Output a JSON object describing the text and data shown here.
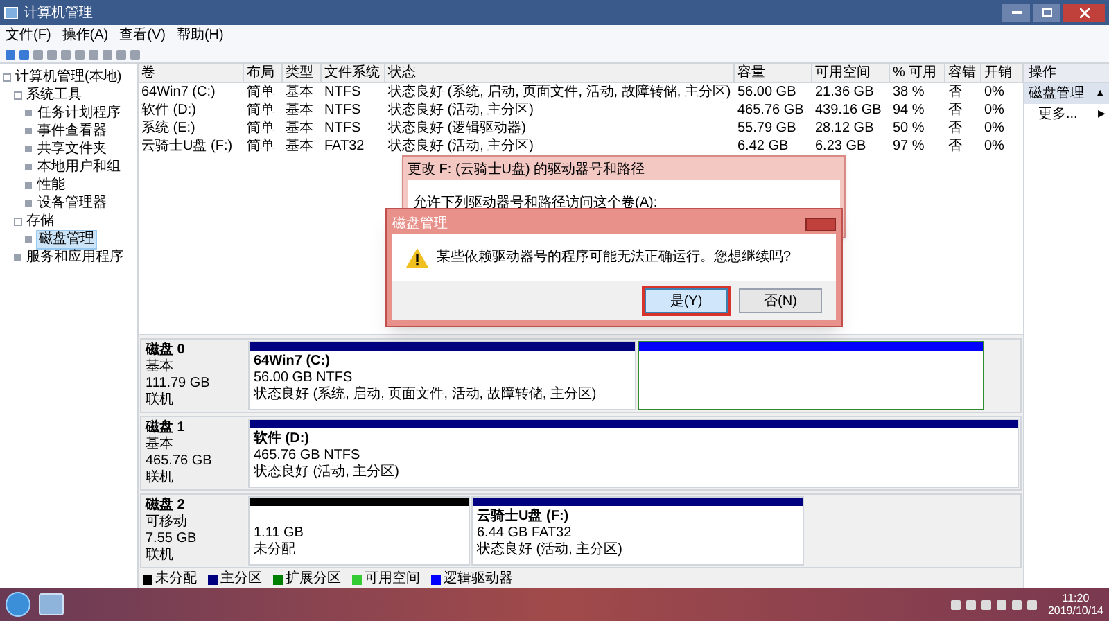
{
  "window": {
    "title": "计算机管理"
  },
  "menu": [
    "文件(F)",
    "操作(A)",
    "查看(V)",
    "帮助(H)"
  ],
  "tree": [
    {
      "label": "计算机管理(本地)",
      "selected": false,
      "children": [
        {
          "label": "系统工具",
          "selected": false,
          "children": [
            {
              "label": "任务计划程序",
              "selected": false
            },
            {
              "label": "事件查看器",
              "selected": false
            },
            {
              "label": "共享文件夹",
              "selected": false
            },
            {
              "label": "本地用户和组",
              "selected": false
            },
            {
              "label": "性能",
              "selected": false
            },
            {
              "label": "设备管理器",
              "selected": false
            }
          ]
        },
        {
          "label": "存储",
          "selected": false,
          "children": [
            {
              "label": "磁盘管理",
              "selected": true
            }
          ]
        },
        {
          "label": "服务和应用程序",
          "selected": false
        }
      ]
    }
  ],
  "volumes": {
    "columns": [
      "卷",
      "布局",
      "类型",
      "文件系统",
      "状态",
      "容量",
      "可用空间",
      "% 可用",
      "容错",
      "开销"
    ],
    "rows": [
      [
        "64Win7 (C:)",
        "简单",
        "基本",
        "NTFS",
        "状态良好 (系统, 启动, 页面文件, 活动, 故障转储, 主分区)",
        "56.00 GB",
        "21.36 GB",
        "38 %",
        "否",
        "0%"
      ],
      [
        "软件 (D:)",
        "简单",
        "基本",
        "NTFS",
        "状态良好 (活动, 主分区)",
        "465.76 GB",
        "439.16 GB",
        "94 %",
        "否",
        "0%"
      ],
      [
        "系统 (E:)",
        "简单",
        "基本",
        "NTFS",
        "状态良好 (逻辑驱动器)",
        "55.79 GB",
        "28.12 GB",
        "50 %",
        "否",
        "0%"
      ],
      [
        "云骑士U盘 (F:)",
        "简单",
        "基本",
        "FAT32",
        "状态良好 (活动, 主分区)",
        "6.42 GB",
        "6.23 GB",
        "97 %",
        "否",
        "0%"
      ]
    ]
  },
  "disks": [
    {
      "name": "磁盘 0",
      "type": "基本",
      "size": "111.79 GB",
      "status": "联机",
      "partitions": [
        {
          "kind": "primary",
          "label": "64Win7  (C:)",
          "detail": "56.00 GB NTFS",
          "status": "状态良好 (系统, 启动, 页面文件, 活动, 故障转储, 主分区)"
        },
        {
          "kind": "logical"
        }
      ]
    },
    {
      "name": "磁盘 1",
      "type": "基本",
      "size": "465.76 GB",
      "status": "联机",
      "partitions": [
        {
          "kind": "primary",
          "label": "软件  (D:)",
          "detail": "465.76 GB NTFS",
          "status": "状态良好 (活动, 主分区)"
        }
      ]
    },
    {
      "name": "磁盘 2",
      "type": "可移动",
      "size": "7.55 GB",
      "status": "联机",
      "partitions": [
        {
          "kind": "unallocated",
          "detail": "1.11 GB",
          "status": "未分配"
        },
        {
          "kind": "primary",
          "label": "云骑士U盘  (F:)",
          "detail": "6.44 GB FAT32",
          "status": "状态良好 (活动, 主分区)"
        }
      ]
    }
  ],
  "legend": [
    {
      "label": "未分配",
      "color": "#000000"
    },
    {
      "label": "主分区",
      "color": "#000080"
    },
    {
      "label": "扩展分区",
      "color": "#008000"
    },
    {
      "label": "可用空间",
      "color": "#33cc33"
    },
    {
      "label": "逻辑驱动器",
      "color": "#0000ff"
    }
  ],
  "actions": {
    "header": "操作",
    "items": [
      {
        "label": "磁盘管理",
        "kind": "section",
        "arrow": "▲"
      },
      {
        "label": "更多...",
        "kind": "item",
        "arrow": "▶"
      }
    ]
  },
  "path_dialog": {
    "title": "更改 F: (云骑士U盘) 的驱动器号和路径",
    "prompt": "允许下列驱动器号和路径访问这个卷(A):"
  },
  "confirm_dialog": {
    "title": "磁盘管理",
    "message": "某些依赖驱动器号的程序可能无法正确运行。您想继续吗?",
    "buttons": [
      {
        "label": "是(Y)",
        "selected": true
      },
      {
        "label": "否(N)",
        "selected": false
      }
    ]
  },
  "taskbar": {
    "time": "11:20",
    "date": "2019/10/14"
  }
}
